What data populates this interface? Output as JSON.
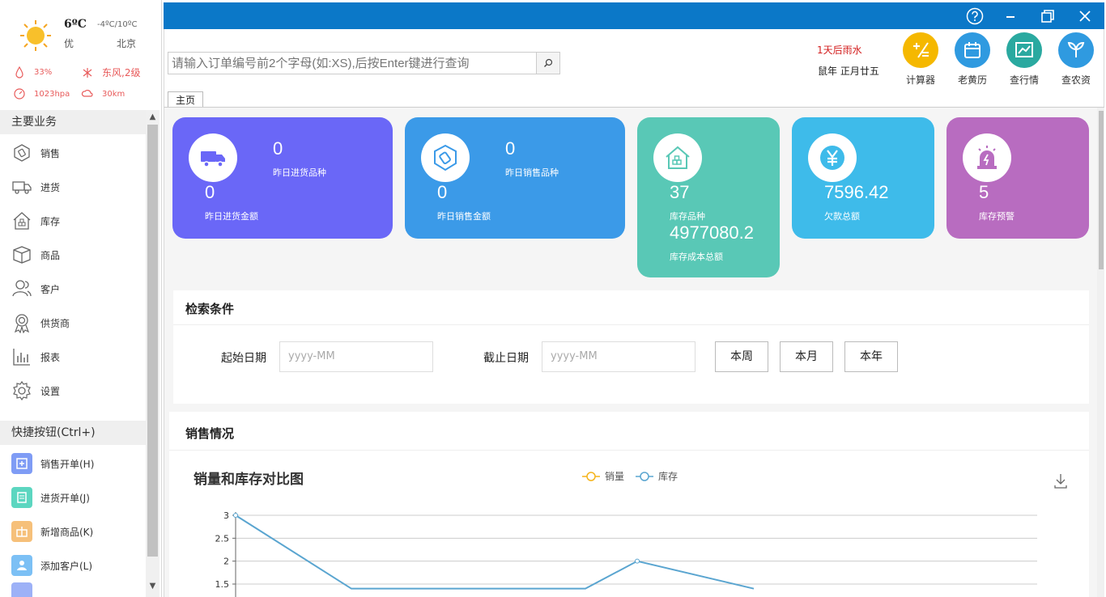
{
  "weather": {
    "temp": "6ºC",
    "range": "-4ºC/10ºC",
    "air_quality": "优",
    "city": "北京",
    "humidity": "33%",
    "wind": "东风,2级",
    "pressure": "1023hpa",
    "visibility": "30km"
  },
  "sidebar": {
    "main_title": "主要业务",
    "items": [
      {
        "label": "销售",
        "icon": "tag-icon"
      },
      {
        "label": "进货",
        "icon": "truck-icon"
      },
      {
        "label": "库存",
        "icon": "warehouse-icon"
      },
      {
        "label": "商品",
        "icon": "box-icon"
      },
      {
        "label": "客户",
        "icon": "customer-icon"
      },
      {
        "label": "供货商",
        "icon": "supplier-icon"
      },
      {
        "label": "报表",
        "icon": "report-icon"
      },
      {
        "label": "设置",
        "icon": "gear-icon"
      }
    ],
    "quick_title": "快捷按钮(Ctrl+)",
    "quick": [
      {
        "label": "销售开单(H)",
        "icon": "new-sale-icon",
        "color": "#7f9cf5"
      },
      {
        "label": "进货开单(J)",
        "icon": "new-purchase-icon",
        "color": "#5cd6c0"
      },
      {
        "label": "新增商品(K)",
        "icon": "new-goods-icon",
        "color": "#f6c07a"
      },
      {
        "label": "添加客户(L)",
        "icon": "add-customer-icon",
        "color": "#7cc0f5"
      }
    ]
  },
  "header": {
    "search_placeholder": "请输入订单编号前2个字母(如:XS),后按Enter键进行查询",
    "forecast": "1天后雨水",
    "lunar": "鼠年 正月廿五",
    "apps": [
      {
        "label": "计算器",
        "icon": "calculator-icon",
        "color": "#f5b800"
      },
      {
        "label": "老黄历",
        "icon": "calendar-icon",
        "color": "#2f9ae0"
      },
      {
        "label": "查行情",
        "icon": "market-icon",
        "color": "#2aa9a0"
      },
      {
        "label": "查农资",
        "icon": "plant-icon",
        "color": "#2f9ae0"
      }
    ],
    "tab": "主页"
  },
  "cards": [
    {
      "color": "#6a67f7",
      "icon": "truck-icon",
      "num1": "0",
      "txt1": "昨日进货品种",
      "num2": "0",
      "txt2": "昨日进货金额"
    },
    {
      "color": "#3b9ae8",
      "icon": "tag-icon",
      "num1": "0",
      "txt1": "昨日销售品种",
      "num2": "0",
      "txt2": "昨日销售金额"
    },
    {
      "color": "#59c8b6",
      "icon": "warehouse-icon",
      "num1": "37",
      "txt1": "库存品种",
      "num2": "4977080.2",
      "txt2": "库存成本总额"
    },
    {
      "color": "#3ebbea",
      "icon": "yen-icon",
      "num1": "7596.42",
      "txt1": "欠款总额"
    },
    {
      "color": "#b86cc0",
      "icon": "alarm-icon",
      "num1": "5",
      "txt1": "库存预警"
    }
  ],
  "search_panel": {
    "title": "检索条件",
    "start_label": "起始日期",
    "start_placeholder": "yyyy-MM",
    "end_label": "截止日期",
    "end_placeholder": "yyyy-MM",
    "btn_week": "本周",
    "btn_month": "本月",
    "btn_year": "本年"
  },
  "sales_panel": {
    "title": "销售情况"
  },
  "chart_data": {
    "type": "line",
    "title": "销量和库存对比图",
    "legend_position": "top-center",
    "series": [
      {
        "name": "销量",
        "color": "#f5b41c",
        "values": []
      },
      {
        "name": "库存",
        "color": "#5aa5d0",
        "values": [
          3,
          1.4,
          1.4,
          1.4,
          2,
          1.4
        ]
      }
    ],
    "yticks": [
      "3",
      "2.5",
      "2",
      "1.5"
    ],
    "ylim": [
      1.5,
      3
    ],
    "grid": true
  }
}
